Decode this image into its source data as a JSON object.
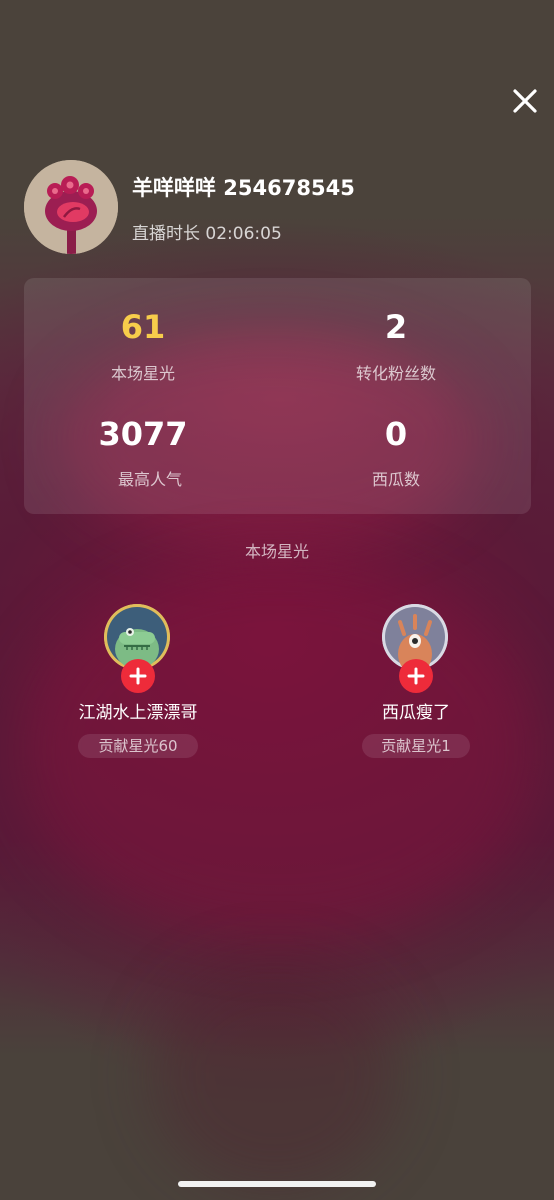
{
  "header": {
    "close_icon": "close-icon",
    "streamer_name_id": "羊咩咩咩 254678545",
    "live_duration": "直播时长 02:06:05"
  },
  "stats": {
    "star_value": "61",
    "star_label": "本场星光",
    "fans_value": "2",
    "fans_label": "转化粉丝数",
    "popularity_value": "3077",
    "popularity_label": "最高人气",
    "watermelon_value": "0",
    "watermelon_label": "西瓜数",
    "accent_color": "#f7cd4b"
  },
  "contributors": {
    "title": "本场星光",
    "items": [
      {
        "name": "江湖水上漂漂哥",
        "badge": "贡献星光60"
      },
      {
        "name": "西瓜瘦了",
        "badge": "贡献星光1"
      }
    ]
  }
}
